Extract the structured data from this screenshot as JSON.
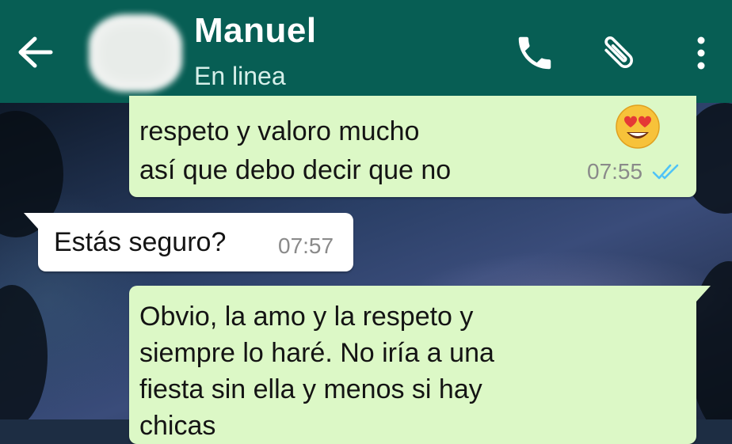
{
  "header": {
    "contact_name": "Manuel",
    "status": "En linea",
    "icons": [
      "back-arrow-icon",
      "phone-icon",
      "paperclip-icon",
      "more-vert-icon"
    ],
    "background_color": "#075e54"
  },
  "messages": [
    {
      "direction": "outgoing",
      "line1": "respeto y valoro mucho",
      "emoji": "heart-eyes-emoji",
      "line2": "así que debo decir que no",
      "time": "07:55",
      "read_receipt": "double-check-read-icon"
    },
    {
      "direction": "incoming",
      "text": "Estás seguro?",
      "time": "07:57"
    },
    {
      "direction": "outgoing",
      "text": "Obvio, la amo y la respeto y\nsiempre lo haré. No iría a una\nfiesta sin ella y menos si hay\nchicas"
    }
  ],
  "colors": {
    "outgoing_bubble": "#dcf8c6",
    "incoming_bubble": "#ffffff",
    "read_tick": "#4fc3f7",
    "timestamp": "#8a8a8a"
  }
}
